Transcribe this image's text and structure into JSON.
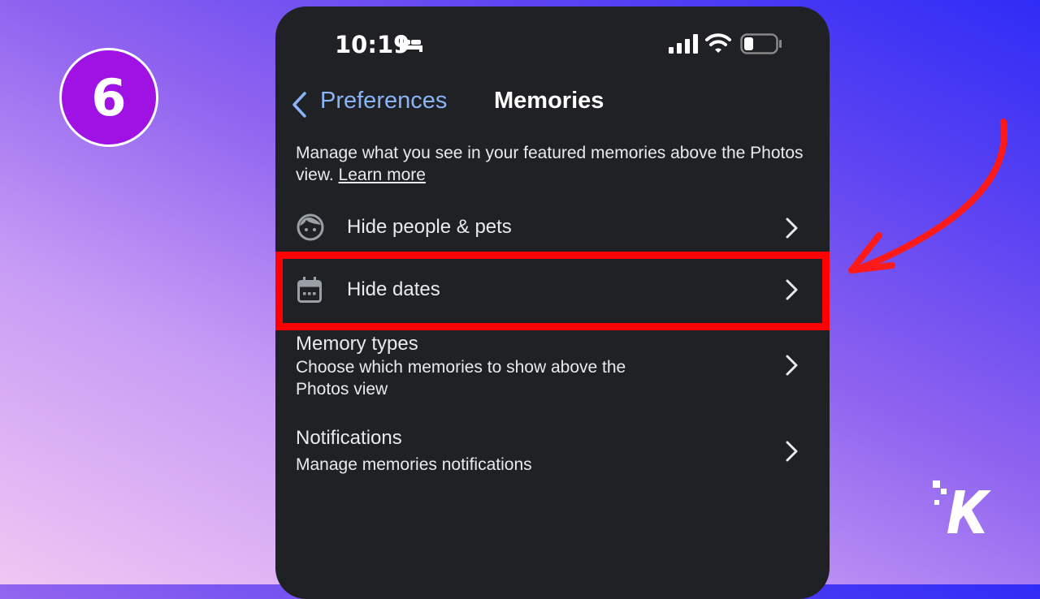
{
  "step": {
    "number": "6",
    "color": "#9f12e3"
  },
  "status_bar": {
    "time": "10:19",
    "icons": [
      "bed-icon",
      "cellular-signal-icon",
      "wifi-icon",
      "battery-icon"
    ]
  },
  "nav": {
    "back_label": "Preferences",
    "title": "Memories",
    "accent": "#8ab4f8"
  },
  "intro": {
    "text": "Manage what you see in your featured memories above the Photos view. ",
    "link": "Learn more"
  },
  "rows": [
    {
      "icon": "face-icon",
      "label": "Hide people & pets"
    },
    {
      "icon": "calendar-icon",
      "label": "Hide dates"
    }
  ],
  "memory_types": {
    "title": "Memory types",
    "subtitle": "Choose which memories to show above the Photos view"
  },
  "notifications": {
    "title": "Notifications",
    "subtitle": "Manage memories notifications"
  },
  "annotation": {
    "highlight_color": "#ff0000",
    "highlighted_item": "Hide dates"
  },
  "brand": {
    "logo_icon": "knowtechie-k-logo"
  }
}
